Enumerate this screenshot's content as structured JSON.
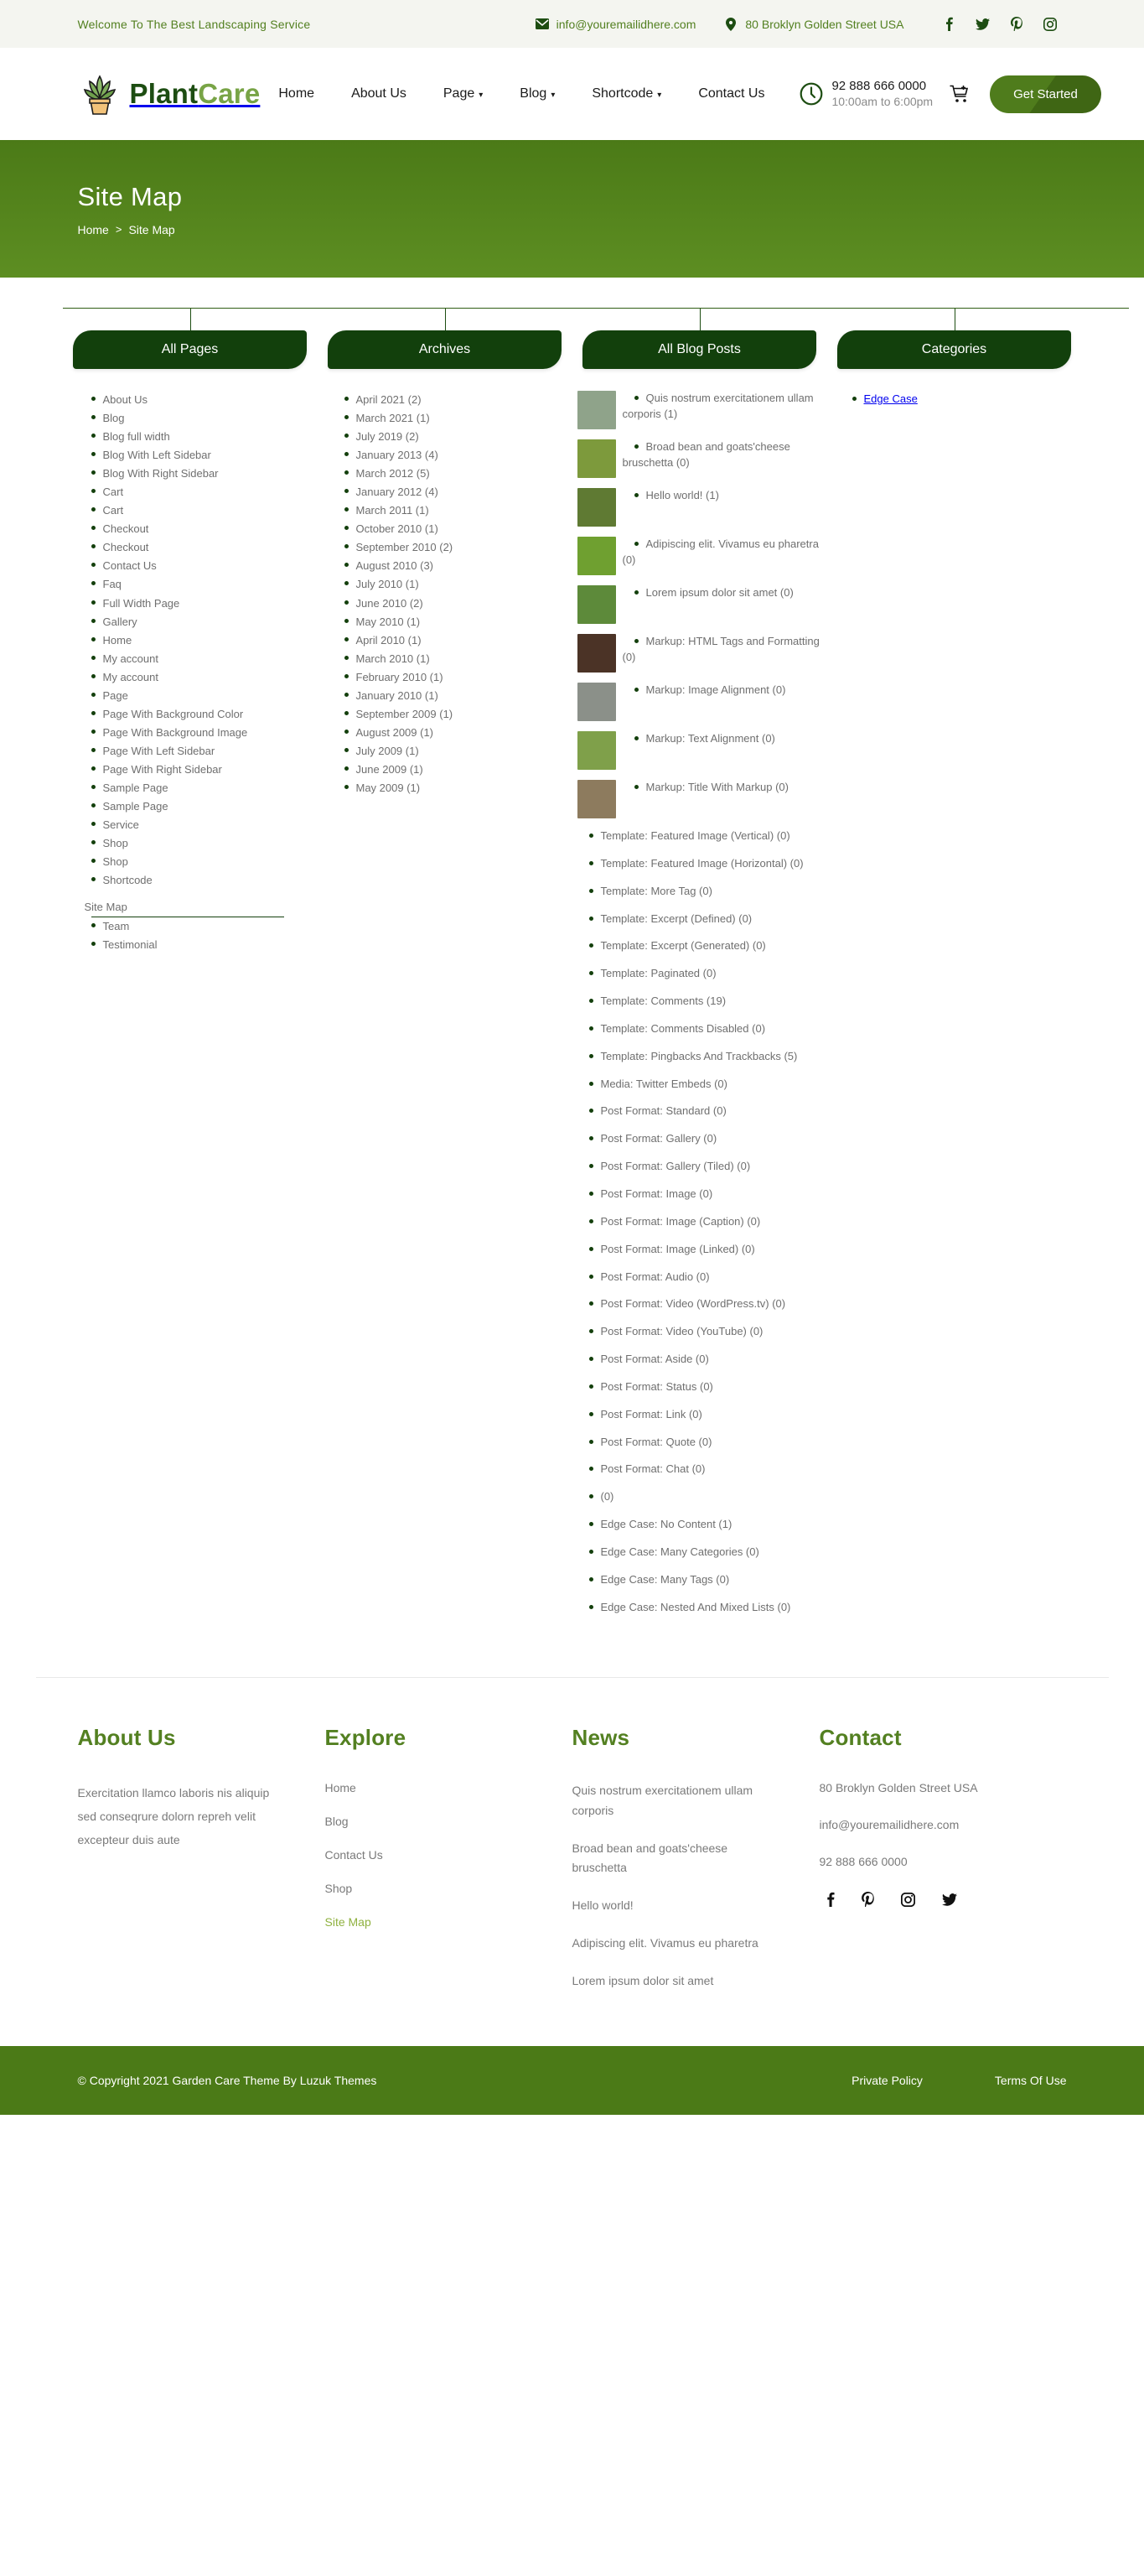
{
  "topbar": {
    "welcome": "Welcome To The Best Landscaping Service",
    "email": "info@youremailidhere.com",
    "address": "80 Broklyn Golden Street USA",
    "social": [
      "facebook-icon",
      "twitter-icon",
      "pinterest-icon",
      "instagram-icon"
    ]
  },
  "header": {
    "logo_a": "Plant",
    "logo_b": "Care",
    "nav": [
      {
        "label": "Home",
        "has_caret": false
      },
      {
        "label": "About Us",
        "has_caret": false
      },
      {
        "label": "Page",
        "has_caret": true
      },
      {
        "label": "Blog",
        "has_caret": true
      },
      {
        "label": "Shortcode",
        "has_caret": true
      },
      {
        "label": "Contact Us",
        "has_caret": false
      }
    ],
    "phone": "92 888 666 0000",
    "hours": "10:00am to 6:00pm",
    "cta": "Get Started"
  },
  "banner": {
    "title": "Site Map",
    "crumb_home": "Home",
    "crumb_sep": ">",
    "crumb_current": "Site Map"
  },
  "sitemap": {
    "columns": [
      {
        "heading": "All Pages"
      },
      {
        "heading": "Archives"
      },
      {
        "heading": "All Blog Posts"
      },
      {
        "heading": "Categories"
      }
    ],
    "all_pages": [
      "About Us",
      "Blog",
      "Blog full width",
      "Blog With Left Sidebar",
      "Blog With Right Sidebar",
      "Cart",
      "Cart",
      "Checkout",
      "Checkout",
      "Contact Us",
      "Faq",
      "Full Width Page",
      "Gallery",
      "Home",
      "My account",
      "My account",
      "Page",
      "Page With Background Color",
      "Page With Background Image",
      "Page With Left Sidebar",
      "Page With Right Sidebar",
      "Sample Page",
      "Sample Page",
      "Service",
      "Shop",
      "Shop",
      "Shortcode"
    ],
    "current_page": "Site Map",
    "all_pages_after": [
      "Team",
      "Testimonial"
    ],
    "archives": [
      "April 2021 (2)",
      "March 2021 (1)",
      "July 2019 (2)",
      "January 2013 (4)",
      "March 2012 (5)",
      "January 2012 (4)",
      "March 2011 (1)",
      "October 2010 (1)",
      "September 2010 (2)",
      "August 2010 (3)",
      "July 2010 (1)",
      "June 2010 (2)",
      "May 2010 (1)",
      "April 2010 (1)",
      "March 2010 (1)",
      "February 2010 (1)",
      "January 2010 (1)",
      "September 2009 (1)",
      "August 2009 (1)",
      "July 2009 (1)",
      "June 2009 (1)",
      "May 2009 (1)"
    ],
    "blog_posts": [
      {
        "title": "Quis nostrum exercitationem ullam corporis (1)",
        "thumb": "#8fa38a"
      },
      {
        "title": "Broad bean and goats'cheese bruschetta (0)",
        "thumb": "#7d9a3c"
      },
      {
        "title": "Hello world! (1)",
        "thumb": "#5f7a33"
      },
      {
        "title": "Adipiscing elit. Vivamus eu pharetra (0)",
        "thumb": "#6fa030"
      },
      {
        "title": "Lorem ipsum dolor sit amet (0)",
        "thumb": "#5d8a3a"
      },
      {
        "title": "Markup: HTML Tags and Formatting (0)",
        "thumb": "#4b3326"
      },
      {
        "title": "Markup: Image Alignment (0)",
        "thumb": "#8b9089"
      },
      {
        "title": "Markup: Text Alignment (0)",
        "thumb": "#7fa04a"
      },
      {
        "title": "Markup: Title With Markup (0)",
        "thumb": "#8d7b5e"
      },
      {
        "title": "Template: Featured Image (Vertical) (0)",
        "thumb": ""
      },
      {
        "title": "Template: Featured Image (Horizontal) (0)",
        "thumb": ""
      },
      {
        "title": "Template: More Tag (0)",
        "thumb": ""
      },
      {
        "title": "Template: Excerpt (Defined) (0)",
        "thumb": ""
      },
      {
        "title": "Template: Excerpt (Generated) (0)",
        "thumb": ""
      },
      {
        "title": "Template: Paginated (0)",
        "thumb": ""
      },
      {
        "title": "Template: Comments (19)",
        "thumb": ""
      },
      {
        "title": "Template: Comments Disabled (0)",
        "thumb": ""
      },
      {
        "title": "Template: Pingbacks And Trackbacks (5)",
        "thumb": ""
      },
      {
        "title": "Media: Twitter Embeds (0)",
        "thumb": ""
      },
      {
        "title": "Post Format: Standard (0)",
        "thumb": ""
      },
      {
        "title": "Post Format: Gallery (0)",
        "thumb": ""
      },
      {
        "title": "Post Format: Gallery (Tiled) (0)",
        "thumb": ""
      },
      {
        "title": "Post Format: Image (0)",
        "thumb": ""
      },
      {
        "title": "Post Format: Image (Caption) (0)",
        "thumb": ""
      },
      {
        "title": "Post Format: Image (Linked) (0)",
        "thumb": ""
      },
      {
        "title": "Post Format: Audio (0)",
        "thumb": ""
      },
      {
        "title": "Post Format: Video (WordPress.tv) (0)",
        "thumb": ""
      },
      {
        "title": "Post Format: Video (YouTube) (0)",
        "thumb": ""
      },
      {
        "title": "Post Format: Aside (0)",
        "thumb": ""
      },
      {
        "title": "Post Format: Status (0)",
        "thumb": ""
      },
      {
        "title": "Post Format: Link (0)",
        "thumb": ""
      },
      {
        "title": "Post Format: Quote (0)",
        "thumb": ""
      },
      {
        "title": "Post Format: Chat (0)",
        "thumb": ""
      },
      {
        "title": "(0)",
        "thumb": ""
      },
      {
        "title": "Edge Case: No Content (1)",
        "thumb": ""
      },
      {
        "title": "Edge Case: Many Categories (0)",
        "thumb": ""
      },
      {
        "title": "Edge Case: Many Tags (0)",
        "thumb": ""
      },
      {
        "title": "Edge Case: Nested And Mixed Lists (0)",
        "thumb": ""
      }
    ],
    "categories": [
      "Edge Case"
    ]
  },
  "footer": {
    "about_title": "About Us",
    "about_text": "Exercitation llamco laboris nis aliquip sed conseqrure dolorn repreh velit excepteur duis aute",
    "explore_title": "Explore",
    "explore_links": [
      {
        "label": "Home",
        "active": false
      },
      {
        "label": "Blog",
        "active": false
      },
      {
        "label": "Contact Us",
        "active": false
      },
      {
        "label": "Shop",
        "active": false
      },
      {
        "label": "Site Map",
        "active": true
      }
    ],
    "news_title": "News",
    "news": [
      "Quis nostrum exercitationem ullam corporis",
      "Broad bean and goats'cheese bruschetta",
      "Hello world!",
      "Adipiscing elit. Vivamus eu pharetra",
      "Lorem ipsum dolor sit amet"
    ],
    "contact_title": "Contact",
    "contact": [
      "80 Broklyn Golden Street USA",
      "info@youremailidhere.com",
      "92 888 666 0000"
    ],
    "social": [
      "facebook-icon",
      "pinterest-icon",
      "instagram-icon",
      "twitter-icon"
    ]
  },
  "copyright": {
    "text": "© Copyright 2021 Garden Care Theme By Luzuk Themes",
    "links": [
      "Private Policy",
      "Terms Of Use"
    ]
  },
  "colors": {
    "brand_dark": "#1d4d12",
    "brand": "#4b7a17",
    "brand_light": "#78a446",
    "header_box": "#12400c",
    "text": "#6f6f6f",
    "topbar_bg": "#f4f5f0"
  }
}
